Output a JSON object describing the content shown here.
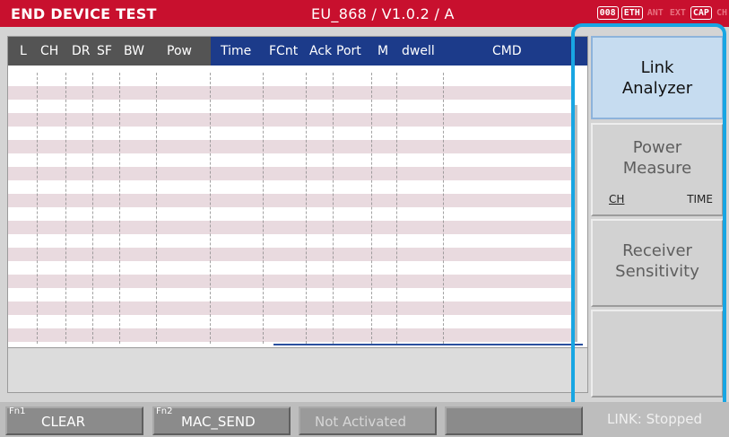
{
  "titlebar": {
    "title": "END DEVICE TEST",
    "mode": "EU_868 / V1.0.2 / A",
    "indicators": [
      "008",
      "ETH",
      "ANT",
      "EXT",
      "CAP",
      "CH"
    ]
  },
  "table": {
    "columns_left": [
      "L",
      "CH",
      "DR",
      "SF",
      "BW",
      "Pow"
    ],
    "columns_right": [
      "Time",
      "FCnt",
      "Ack",
      "Port",
      "M",
      "dwell",
      "CMD"
    ]
  },
  "softkeys": {
    "link_analyzer": {
      "line1": "Link",
      "line2": "Analyzer"
    },
    "power_measure": {
      "line1": "Power",
      "line2": "Measure",
      "sub_left": "CH",
      "sub_right": "TIME"
    },
    "receiver_sensitivity": {
      "line1": "Receiver",
      "line2": "Sensitivity"
    }
  },
  "function_bar": {
    "f1": {
      "fn": "Fn1",
      "label": "CLEAR"
    },
    "f2": {
      "fn": "Fn2",
      "label": "MAC_SEND"
    },
    "f3": {
      "label": "Not Activated"
    },
    "status": "LINK: Stopped"
  },
  "colors": {
    "titlebar": "#c8102e",
    "header_left": "#545454",
    "header_right": "#1c3b8a",
    "highlight": "#18a6e3",
    "active_softkey": "#c6dcf0"
  }
}
